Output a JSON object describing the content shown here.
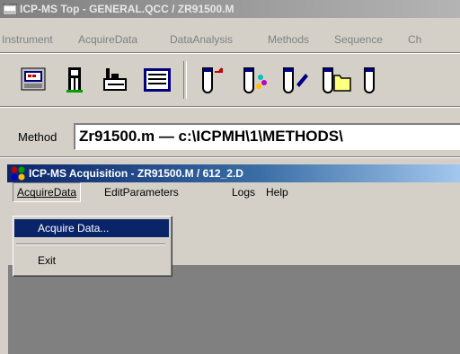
{
  "outer_window": {
    "title": "ICP-MS Top - GENERAL.QCC / ZR91500.M",
    "menu": [
      "Instrument",
      "AcquireData",
      "DataAnalysis",
      "Methods",
      "Sequence",
      "Ch"
    ]
  },
  "toolbar": {
    "buttons": [
      "keyboard-icon",
      "instrument-icon",
      "tune-icon",
      "calibration-screen-icon",
      "vial-arrow-icon",
      "vial-sparkle-icon",
      "vial-pencil-icon",
      "vial-folder-icon",
      "vial-icon"
    ]
  },
  "method_bar": {
    "label": "Method",
    "value": "Zr91500.m  —  c:\\ICPMH\\1\\METHODS\\"
  },
  "inner_window": {
    "title": "ICP-MS Acquisition - ZR91500.M / 612_2.D",
    "menu": [
      "AcquireData",
      "EditParameters",
      "Logs",
      "Help"
    ]
  },
  "dropdown": {
    "items": [
      "Acquire Data...",
      "Exit"
    ]
  },
  "colors": {
    "menu_bg": "#d4d0c8",
    "active_title": "#0a246a",
    "inactive_title": "#808080",
    "selection": "#0a246a"
  }
}
